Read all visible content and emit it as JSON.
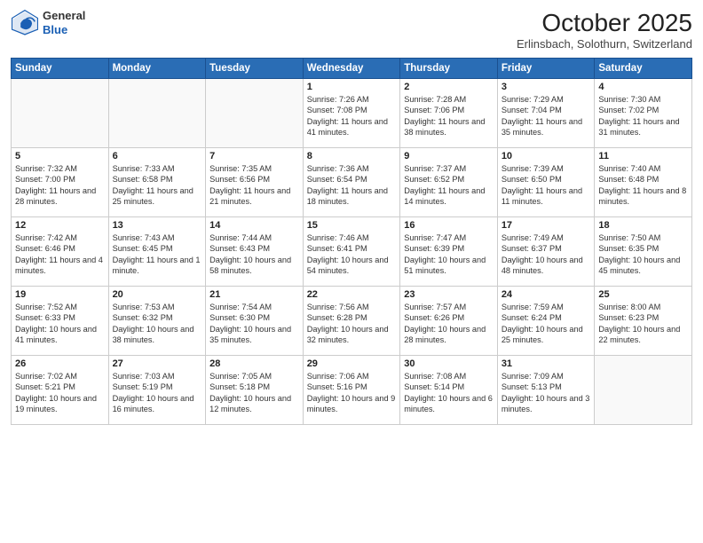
{
  "header": {
    "logo_general": "General",
    "logo_blue": "Blue",
    "title": "October 2025",
    "location": "Erlinsbach, Solothurn, Switzerland"
  },
  "days_of_week": [
    "Sunday",
    "Monday",
    "Tuesday",
    "Wednesday",
    "Thursday",
    "Friday",
    "Saturday"
  ],
  "weeks": [
    [
      {
        "day": "",
        "text": ""
      },
      {
        "day": "",
        "text": ""
      },
      {
        "day": "",
        "text": ""
      },
      {
        "day": "1",
        "text": "Sunrise: 7:26 AM\nSunset: 7:08 PM\nDaylight: 11 hours and 41 minutes."
      },
      {
        "day": "2",
        "text": "Sunrise: 7:28 AM\nSunset: 7:06 PM\nDaylight: 11 hours and 38 minutes."
      },
      {
        "day": "3",
        "text": "Sunrise: 7:29 AM\nSunset: 7:04 PM\nDaylight: 11 hours and 35 minutes."
      },
      {
        "day": "4",
        "text": "Sunrise: 7:30 AM\nSunset: 7:02 PM\nDaylight: 11 hours and 31 minutes."
      }
    ],
    [
      {
        "day": "5",
        "text": "Sunrise: 7:32 AM\nSunset: 7:00 PM\nDaylight: 11 hours and 28 minutes."
      },
      {
        "day": "6",
        "text": "Sunrise: 7:33 AM\nSunset: 6:58 PM\nDaylight: 11 hours and 25 minutes."
      },
      {
        "day": "7",
        "text": "Sunrise: 7:35 AM\nSunset: 6:56 PM\nDaylight: 11 hours and 21 minutes."
      },
      {
        "day": "8",
        "text": "Sunrise: 7:36 AM\nSunset: 6:54 PM\nDaylight: 11 hours and 18 minutes."
      },
      {
        "day": "9",
        "text": "Sunrise: 7:37 AM\nSunset: 6:52 PM\nDaylight: 11 hours and 14 minutes."
      },
      {
        "day": "10",
        "text": "Sunrise: 7:39 AM\nSunset: 6:50 PM\nDaylight: 11 hours and 11 minutes."
      },
      {
        "day": "11",
        "text": "Sunrise: 7:40 AM\nSunset: 6:48 PM\nDaylight: 11 hours and 8 minutes."
      }
    ],
    [
      {
        "day": "12",
        "text": "Sunrise: 7:42 AM\nSunset: 6:46 PM\nDaylight: 11 hours and 4 minutes."
      },
      {
        "day": "13",
        "text": "Sunrise: 7:43 AM\nSunset: 6:45 PM\nDaylight: 11 hours and 1 minute."
      },
      {
        "day": "14",
        "text": "Sunrise: 7:44 AM\nSunset: 6:43 PM\nDaylight: 10 hours and 58 minutes."
      },
      {
        "day": "15",
        "text": "Sunrise: 7:46 AM\nSunset: 6:41 PM\nDaylight: 10 hours and 54 minutes."
      },
      {
        "day": "16",
        "text": "Sunrise: 7:47 AM\nSunset: 6:39 PM\nDaylight: 10 hours and 51 minutes."
      },
      {
        "day": "17",
        "text": "Sunrise: 7:49 AM\nSunset: 6:37 PM\nDaylight: 10 hours and 48 minutes."
      },
      {
        "day": "18",
        "text": "Sunrise: 7:50 AM\nSunset: 6:35 PM\nDaylight: 10 hours and 45 minutes."
      }
    ],
    [
      {
        "day": "19",
        "text": "Sunrise: 7:52 AM\nSunset: 6:33 PM\nDaylight: 10 hours and 41 minutes."
      },
      {
        "day": "20",
        "text": "Sunrise: 7:53 AM\nSunset: 6:32 PM\nDaylight: 10 hours and 38 minutes."
      },
      {
        "day": "21",
        "text": "Sunrise: 7:54 AM\nSunset: 6:30 PM\nDaylight: 10 hours and 35 minutes."
      },
      {
        "day": "22",
        "text": "Sunrise: 7:56 AM\nSunset: 6:28 PM\nDaylight: 10 hours and 32 minutes."
      },
      {
        "day": "23",
        "text": "Sunrise: 7:57 AM\nSunset: 6:26 PM\nDaylight: 10 hours and 28 minutes."
      },
      {
        "day": "24",
        "text": "Sunrise: 7:59 AM\nSunset: 6:24 PM\nDaylight: 10 hours and 25 minutes."
      },
      {
        "day": "25",
        "text": "Sunrise: 8:00 AM\nSunset: 6:23 PM\nDaylight: 10 hours and 22 minutes."
      }
    ],
    [
      {
        "day": "26",
        "text": "Sunrise: 7:02 AM\nSunset: 5:21 PM\nDaylight: 10 hours and 19 minutes."
      },
      {
        "day": "27",
        "text": "Sunrise: 7:03 AM\nSunset: 5:19 PM\nDaylight: 10 hours and 16 minutes."
      },
      {
        "day": "28",
        "text": "Sunrise: 7:05 AM\nSunset: 5:18 PM\nDaylight: 10 hours and 12 minutes."
      },
      {
        "day": "29",
        "text": "Sunrise: 7:06 AM\nSunset: 5:16 PM\nDaylight: 10 hours and 9 minutes."
      },
      {
        "day": "30",
        "text": "Sunrise: 7:08 AM\nSunset: 5:14 PM\nDaylight: 10 hours and 6 minutes."
      },
      {
        "day": "31",
        "text": "Sunrise: 7:09 AM\nSunset: 5:13 PM\nDaylight: 10 hours and 3 minutes."
      },
      {
        "day": "",
        "text": ""
      }
    ]
  ]
}
